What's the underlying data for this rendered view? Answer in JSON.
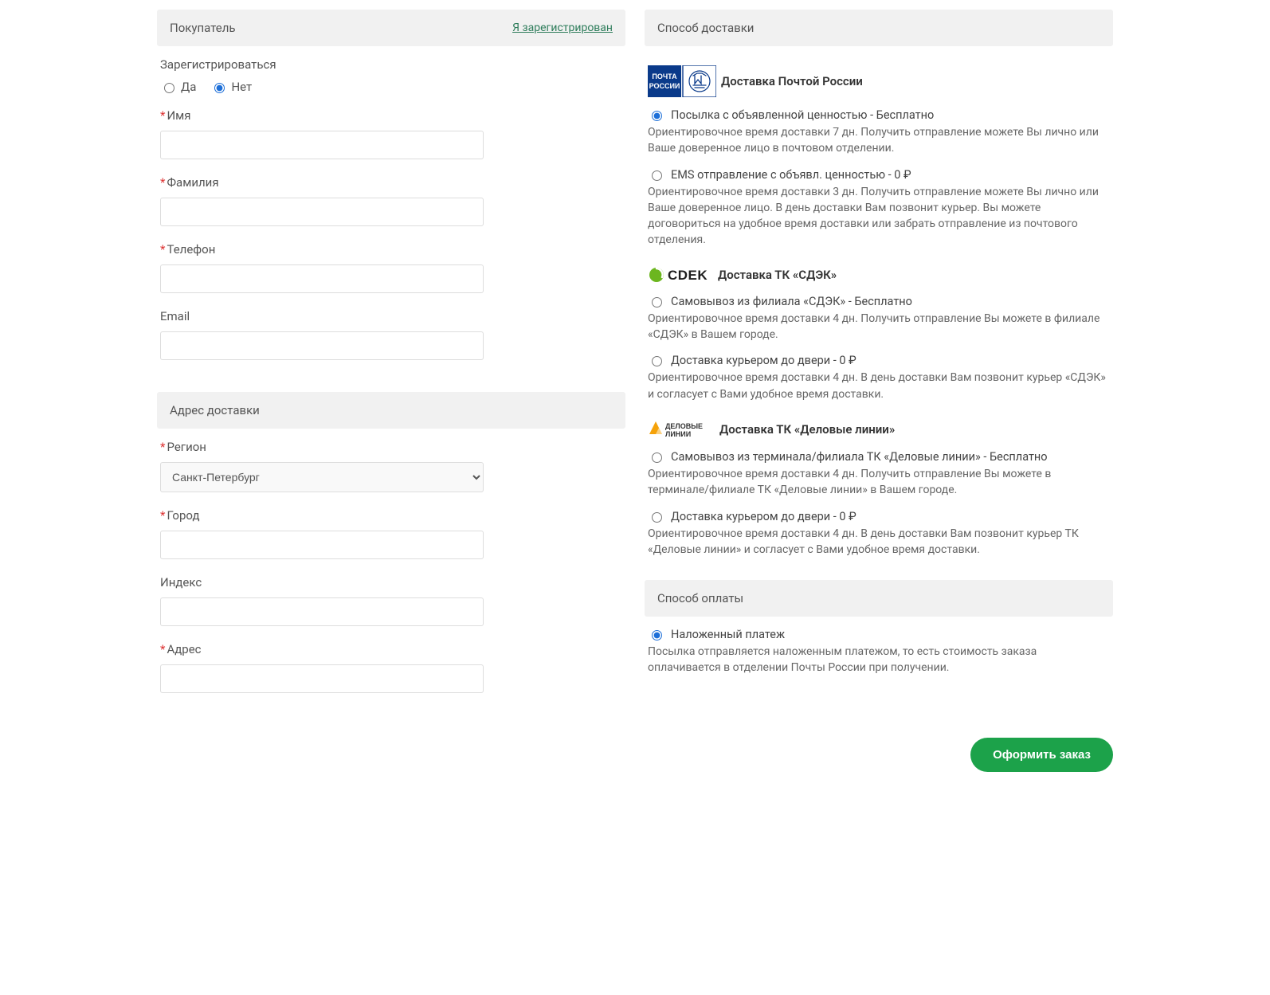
{
  "buyer": {
    "header": "Покупатель",
    "registered_link": "Я зарегистрирован",
    "register_title": "Зарегистрироваться",
    "yes": "Да",
    "no": "Нет",
    "name_label": "Имя",
    "surname_label": "Фамилия",
    "phone_label": "Телефон",
    "email_label": "Email"
  },
  "address": {
    "header": "Адрес доставки",
    "region_label": "Регион",
    "region_value": "Санкт-Петербург",
    "city_label": "Город",
    "index_label": "Индекс",
    "address_label": "Адрес"
  },
  "shipping": {
    "header": "Способ доставки",
    "russian_post": {
      "title": "Доставка Почтой России",
      "opt1_label": "Посылка с объявленной ценностью - Бесплатно",
      "opt1_desc": "Ориентировочное время доставки 7 дн. Получить отправление можете Вы лично или Ваше доверенное лицо в почтовом отделении.",
      "opt2_label": "EMS отправление с объявл. ценностью - 0 ₽",
      "opt2_desc": "Ориентировочное время доставки 3 дн. Получить отправление можете Вы лично или Ваше доверенное лицо. В день доставки Вам позвонит курьер. Вы можете договориться на удобное время доставки или забрать отправление из почтового отделения."
    },
    "cdek": {
      "title": "Доставка ТК «СДЭК»",
      "opt1_label": "Самовывоз из филиала «СДЭК» - Бесплатно",
      "opt1_desc": "Ориентировочное время доставки 4 дн. Получить отправление Вы можете в филиале «СДЭК» в Вашем городе.",
      "opt2_label": "Доставка курьером до двери - 0 ₽",
      "opt2_desc": "Ориентировочное время доставки 4 дн. В день доставки Вам позвонит курьер «СДЭК» и согласует с Вами удобное время доставки."
    },
    "dl": {
      "title": "Доставка ТК «Деловые линии»",
      "opt1_label": "Самовывоз из терминала/филиала ТК «Деловые линии» - Бесплатно",
      "opt1_desc": "Ориентировочное время доставки 4 дн. Получить отправление Вы можете в терминале/филиале ТК «Деловые линии» в Вашем городе.",
      "opt2_label": "Доставка курьером до двери - 0 ₽",
      "opt2_desc": "Ориентировочное время доставки 4 дн. В день доставки Вам позвонит курьер ТК «Деловые линии» и согласует с Вами удобное время доставки."
    }
  },
  "payment": {
    "header": "Способ оплаты",
    "opt1_label": "Наложенный платеж",
    "opt1_desc": "Посылка отправляется наложенным платежом, то есть стоимость заказа оплачивается в отделении Почты России при получении."
  },
  "submit_label": "Оформить заказ"
}
